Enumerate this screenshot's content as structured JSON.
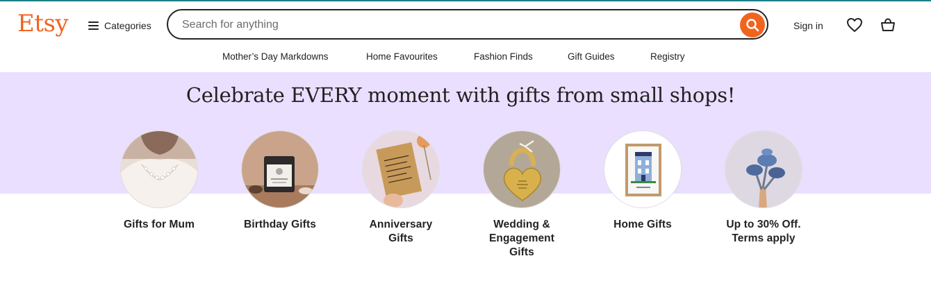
{
  "brand": {
    "logo_text": "Etsy",
    "accent_color": "#f1641e"
  },
  "header": {
    "categories_label": "Categories",
    "search": {
      "placeholder": "Search for anything",
      "value": ""
    },
    "sign_in_label": "Sign in",
    "icons": [
      "hamburger-icon",
      "search-icon",
      "heart-icon",
      "shopping-bag-icon"
    ]
  },
  "nav": {
    "items": [
      {
        "label": "Mother’s Day Markdowns"
      },
      {
        "label": "Home Favourites"
      },
      {
        "label": "Fashion Finds"
      },
      {
        "label": "Gift Guides"
      },
      {
        "label": "Registry"
      }
    ]
  },
  "banner": {
    "headline": "Celebrate EVERY moment with gifts from small shops!",
    "background_color": "#eadfff"
  },
  "categories": [
    {
      "label": "Gifts for Mum"
    },
    {
      "label": "Birthday Gifts"
    },
    {
      "label": "Anniversary\nGifts"
    },
    {
      "label": "Wedding &\nEngagement\nGifts"
    },
    {
      "label": "Home Gifts"
    },
    {
      "label": "Up to 30% Off.\nTerms apply"
    }
  ]
}
